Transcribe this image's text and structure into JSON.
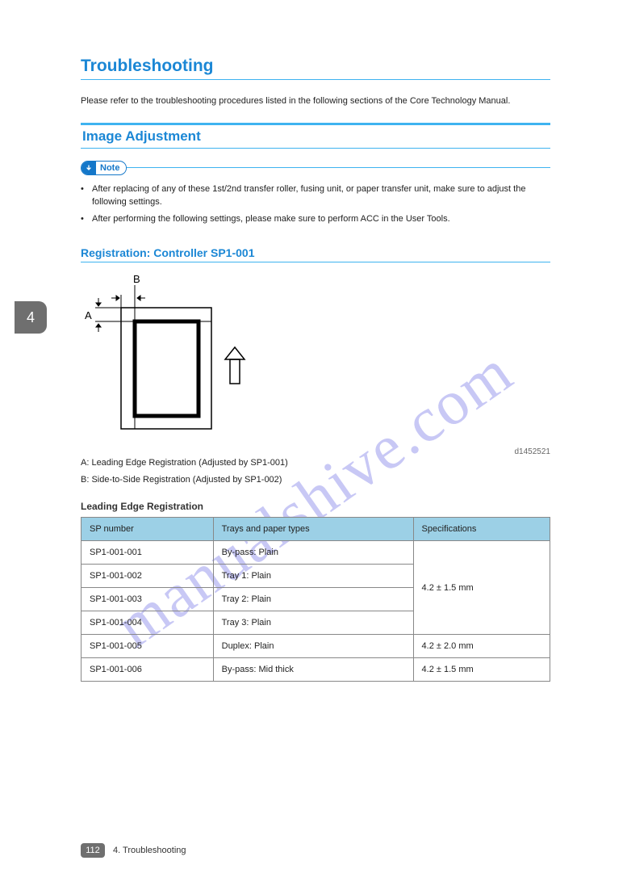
{
  "tab_index": "4",
  "watermark": "manualshive.com",
  "h1": "Troubleshooting",
  "intro": "Please refer to the troubleshooting procedures listed in the following sections of the Core Technology Manual.",
  "h2": "Image Adjustment",
  "note_label": "Note",
  "note_bullets": [
    "After replacing of any of these 1st/2nd transfer roller, fusing unit, or paper transfer unit, make sure to adjust the following settings.",
    "After performing the following settings, please make sure to perform ACC in the User Tools."
  ],
  "h3": "Registration: Controller SP1-001",
  "diagram": {
    "label_a": "A",
    "label_b": "B",
    "code": "d1452521"
  },
  "legend": [
    "A: Leading Edge Registration (Adjusted by SP1-001)",
    "B: Side-to-Side Registration (Adjusted by SP1-002)"
  ],
  "sub_heading": "Leading Edge Registration",
  "table": {
    "headers": [
      "SP number",
      "Trays and paper types",
      "Specifications"
    ],
    "rows": [
      {
        "sp": "SP1-001-001",
        "tray": "By-pass: Plain",
        "spec_span": 4,
        "spec": "4.2 ± 1.5 mm"
      },
      {
        "sp": "SP1-001-002",
        "tray": "Tray 1: Plain"
      },
      {
        "sp": "SP1-001-003",
        "tray": "Tray 2: Plain"
      },
      {
        "sp": "SP1-001-004",
        "tray": "Tray 3: Plain"
      },
      {
        "sp": "SP1-001-005",
        "tray": "Duplex: Plain",
        "spec_span": 1,
        "spec": "4.2 ± 2.0 mm"
      },
      {
        "sp": "SP1-001-006",
        "tray": "By-pass: Mid thick",
        "spec_span": 1,
        "spec": "4.2 ± 1.5 mm"
      }
    ]
  },
  "footer": {
    "page_num": "112",
    "chapter": "4. Troubleshooting"
  }
}
